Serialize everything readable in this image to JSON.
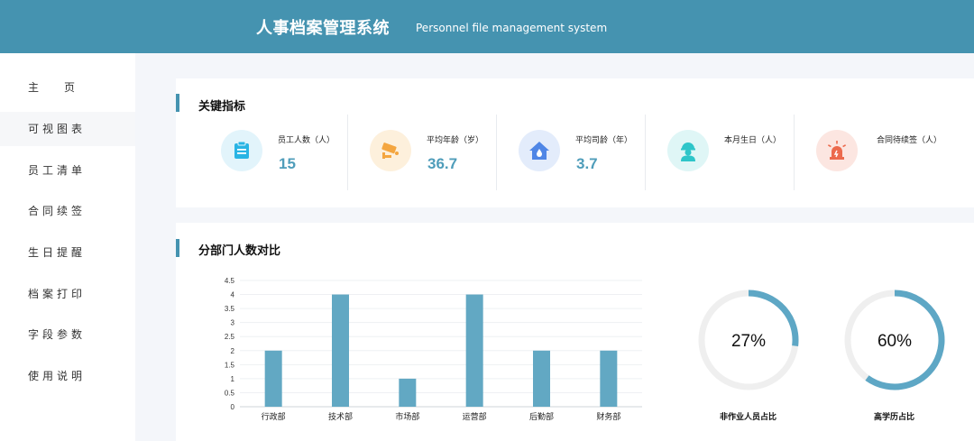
{
  "header": {
    "title": "人事档案管理系统",
    "subtitle": "Personnel file management system"
  },
  "sidebar": {
    "items": [
      {
        "label": "主页",
        "active": false
      },
      {
        "label": "可视图表",
        "active": true
      },
      {
        "label": "员工清单",
        "active": false
      },
      {
        "label": "合同续签",
        "active": false
      },
      {
        "label": "生日提醒",
        "active": false
      },
      {
        "label": "档案打印",
        "active": false
      },
      {
        "label": "字段参数",
        "active": false
      },
      {
        "label": "使用说明",
        "active": false
      }
    ]
  },
  "kpi_section": {
    "title": "关键指标",
    "items": [
      {
        "label": "员工人数（人）",
        "value": "15",
        "icon": "clipboard-icon",
        "color": "#29b4e4",
        "bg": "#e2f4fb"
      },
      {
        "label": "平均年龄（岁）",
        "value": "36.7",
        "icon": "camera-icon",
        "color": "#f4a640",
        "bg": "#fdf0dc"
      },
      {
        "label": "平均司龄（年）",
        "value": "3.7",
        "icon": "house-drop-icon",
        "color": "#4f86e6",
        "bg": "#e3ecfb"
      },
      {
        "label": "本月生日（人）",
        "value": "",
        "icon": "worker-icon",
        "color": "#2ec5c9",
        "bg": "#dff6f6"
      },
      {
        "label": "合同待续签（人）",
        "value": "",
        "icon": "alarm-icon",
        "color": "#ec6a4d",
        "bg": "#fce6e1"
      }
    ]
  },
  "chart_section": {
    "title": "分部门人数对比"
  },
  "chart_data": [
    {
      "type": "bar",
      "categories": [
        "行政部",
        "技术部",
        "市场部",
        "运营部",
        "后勤部",
        "财务部"
      ],
      "values": [
        2,
        4,
        1,
        4,
        2,
        2
      ],
      "ylim": [
        0,
        4.5
      ],
      "yticks": [
        "0",
        "0.5",
        "1",
        "1.5",
        "2",
        "2.5",
        "3",
        "3.5",
        "4",
        "4.5"
      ],
      "grid": true,
      "color": "#62a8c3"
    },
    {
      "type": "pie",
      "values": [
        27,
        73
      ],
      "center_text": "27%",
      "title": "非作业人员占比",
      "color": "#5ea7c5",
      "track_color": "#efefef"
    },
    {
      "type": "pie",
      "values": [
        60,
        40
      ],
      "center_text": "60%",
      "title": "高学历占比",
      "color": "#5ea7c5",
      "track_color": "#efefef"
    }
  ]
}
